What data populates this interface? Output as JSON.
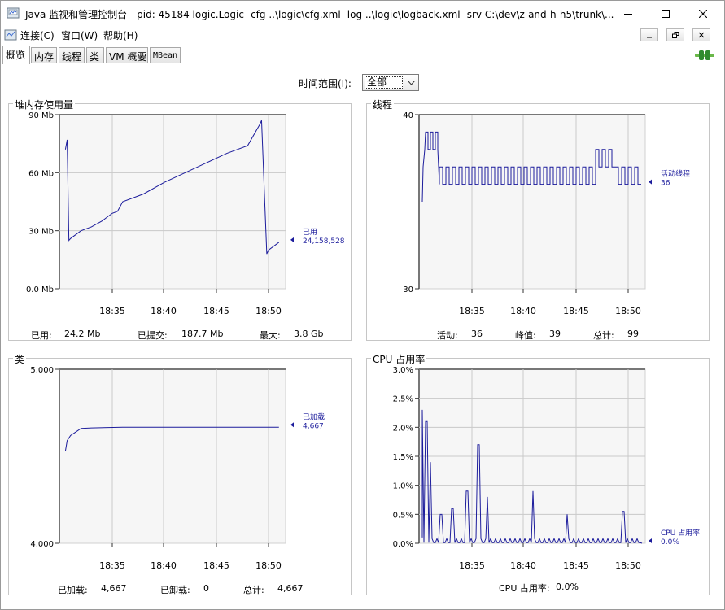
{
  "window": {
    "title": "Java 监视和管理控制台 - pid: 45184 logic.Logic -cfg ..\\logic\\cfg.xml -log ..\\logic\\logback.xml -srv C:\\dev\\z-and-h-h5\\trunk\\..."
  },
  "menu": [
    "连接(C)",
    "窗口(W)",
    "帮助(H)"
  ],
  "tabs": [
    "概览",
    "内存",
    "线程",
    "类",
    "VM 概要",
    "MBean"
  ],
  "active_tab": "概览",
  "time_range": {
    "label": "时间范围(I):",
    "value": "全部"
  },
  "colors": {
    "series": "#1c1c9c",
    "plot_bg": "#f6f6f6",
    "grid": "#c9c9c9"
  },
  "charts": {
    "heap": {
      "title": "堆内存使用量",
      "footer": [
        {
          "label": "已用:",
          "value": "24.2  Mb"
        },
        {
          "label": "已提交:",
          "value": "187.7  Mb"
        },
        {
          "label": "最大:",
          "value": "3.8  Gb"
        }
      ]
    },
    "threads": {
      "title": "线程",
      "footer": [
        {
          "label": "活动:",
          "value": "36"
        },
        {
          "label": "峰值:",
          "value": "39"
        },
        {
          "label": "总计:",
          "value": "99"
        }
      ]
    },
    "classes": {
      "title": "类",
      "footer": [
        {
          "label": "已加载:",
          "value": "4,667"
        },
        {
          "label": "已卸载:",
          "value": "0"
        },
        {
          "label": "总计:",
          "value": "4,667"
        }
      ]
    },
    "cpu": {
      "title": "CPU 占用率",
      "footer": [
        {
          "label": "CPU 占用率:",
          "value": "0.0%"
        }
      ]
    }
  },
  "chart_data": [
    {
      "type": "line",
      "title": "堆内存使用量",
      "x_ticks": [
        "18:35",
        "18:40",
        "18:45",
        "18:50"
      ],
      "y_ticks": [
        "90 Mb",
        "60 Mb",
        "30 Mb",
        "0.0 Mb"
      ],
      "ylim": [
        0,
        90
      ],
      "grid": true,
      "series": [
        {
          "name": "已用",
          "current": "24,158,528",
          "x": [
            "18:30:30",
            "18:30:40",
            "18:30:50",
            "18:31:00",
            "18:32:00",
            "18:33:00",
            "18:34:00",
            "18:34:30",
            "18:35:00",
            "18:35:30",
            "18:36:00",
            "18:38:00",
            "18:40:00",
            "18:42:00",
            "18:44:00",
            "18:46:00",
            "18:48:00",
            "18:49:10",
            "18:49:20",
            "18:49:50",
            "18:50:00",
            "18:50:30",
            "18:51:00"
          ],
          "y": [
            72,
            77,
            25,
            26,
            30,
            32,
            35,
            37,
            39,
            40,
            45,
            49,
            55,
            60,
            65,
            70,
            74,
            85,
            87,
            18,
            20,
            22,
            24
          ]
        }
      ]
    },
    {
      "type": "line",
      "title": "线程",
      "x_ticks": [
        "18:35",
        "18:40",
        "18:45",
        "18:50"
      ],
      "y_ticks": [
        "40",
        "30"
      ],
      "ylim": [
        30,
        40
      ],
      "grid": true,
      "series": [
        {
          "name": "活动线程",
          "current": "36",
          "levels": [
            35,
            37,
            39,
            38,
            36,
            37,
            38
          ],
          "pattern": "oscillates between 36 and 37, peak 39 near start, 38 around 18:48"
        }
      ]
    },
    {
      "type": "line",
      "title": "类",
      "x_ticks": [
        "18:35",
        "18:40",
        "18:45",
        "18:50"
      ],
      "y_ticks": [
        "5,000",
        "4,000"
      ],
      "ylim": [
        4000,
        5000
      ],
      "grid": true,
      "series": [
        {
          "name": "已加载",
          "current": "4,667",
          "x": [
            "18:30:30",
            "18:30:40",
            "18:31:00",
            "18:31:30",
            "18:32:00",
            "18:33:00",
            "18:36:00",
            "18:51:00"
          ],
          "y": [
            4530,
            4590,
            4620,
            4640,
            4660,
            4663,
            4667,
            4667
          ]
        }
      ]
    },
    {
      "type": "line",
      "title": "CPU 占用率",
      "x_ticks": [
        "18:35",
        "18:40",
        "18:45",
        "18:50"
      ],
      "y_ticks": [
        "3.0%",
        "2.5%",
        "2.0%",
        "1.5%",
        "1.0%",
        "0.5%",
        "0.0%"
      ],
      "ylim": [
        0,
        3.0
      ],
      "grid": true,
      "series": [
        {
          "name": "CPU 占用率",
          "current": "0.0%",
          "spikes": [
            {
              "x": "18:30:10",
              "y": 2.3
            },
            {
              "x": "18:30:35",
              "y": 2.1
            },
            {
              "x": "18:31:00",
              "y": 1.4
            },
            {
              "x": "18:32:00",
              "y": 0.5
            },
            {
              "x": "18:33:10",
              "y": 0.6
            },
            {
              "x": "18:34:30",
              "y": 0.9
            },
            {
              "x": "18:35:40",
              "y": 1.7
            },
            {
              "x": "18:36:30",
              "y": 0.8
            },
            {
              "x": "18:40:50",
              "y": 0.9
            },
            {
              "x": "18:44:10",
              "y": 0.5
            },
            {
              "x": "18:49:30",
              "y": 0.55
            }
          ]
        }
      ]
    }
  ]
}
